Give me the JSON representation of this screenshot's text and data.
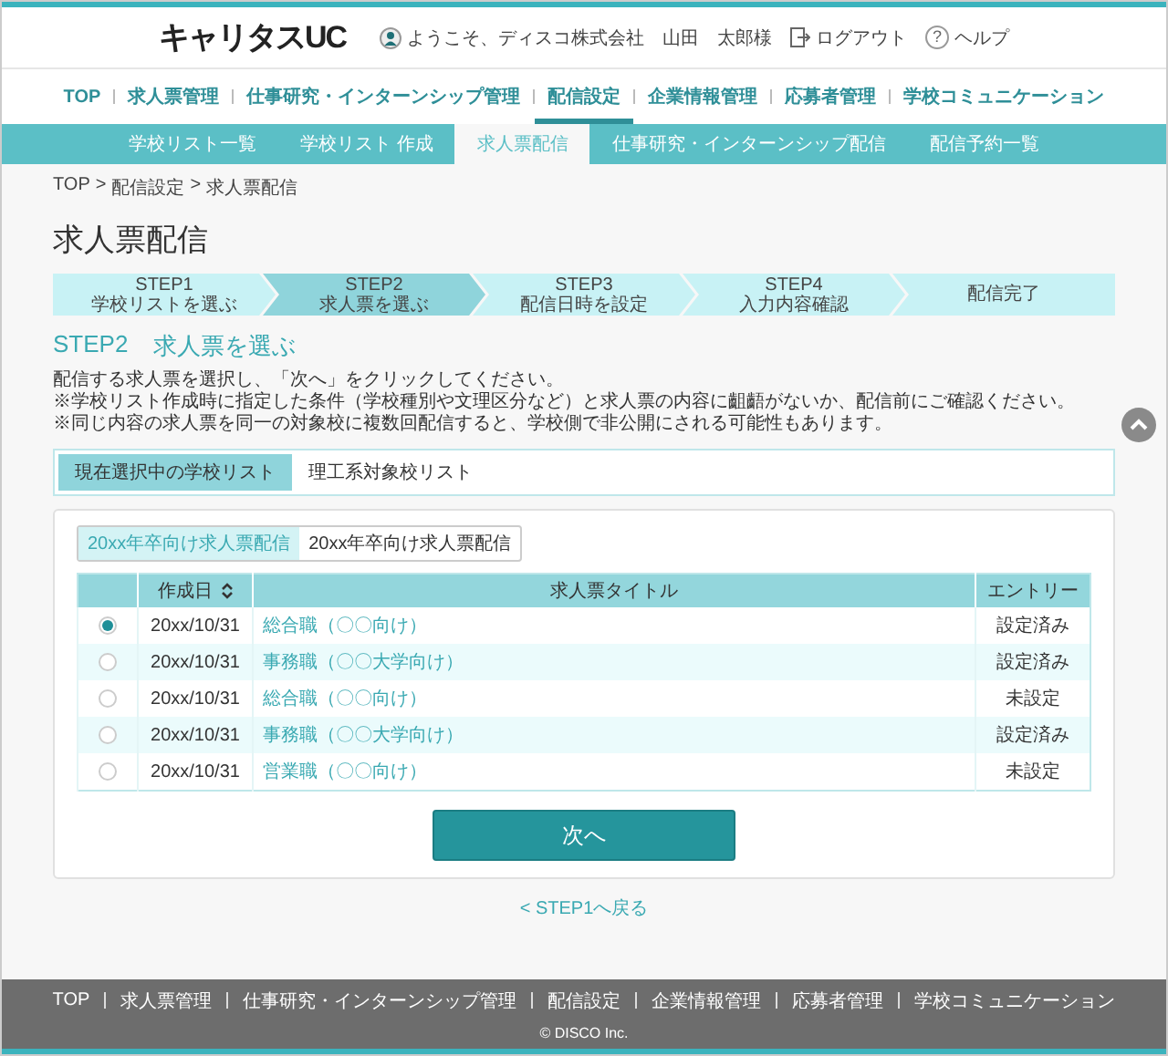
{
  "header": {
    "logo": "キャリタスUC",
    "welcome": "ようこそ、ディスコ株式会社　山田　太郎様",
    "logout": "ログアウト",
    "help": {
      "icon": "?",
      "label": "ヘルプ"
    }
  },
  "main_nav": [
    {
      "label": "TOP",
      "selected": false
    },
    {
      "label": "求人票管理",
      "selected": false
    },
    {
      "label": "仕事研究・インターンシップ管理",
      "selected": false
    },
    {
      "label": "配信設定",
      "selected": true
    },
    {
      "label": "企業情報管理",
      "selected": false
    },
    {
      "label": "応募者管理",
      "selected": false
    },
    {
      "label": "学校コミュニケーション",
      "selected": false
    }
  ],
  "sub_nav": [
    {
      "label": "学校リスト一覧",
      "selected": false
    },
    {
      "label": "学校リスト 作成",
      "selected": false
    },
    {
      "label": "求人票配信",
      "selected": true
    },
    {
      "label": "仕事研究・インターンシップ配信",
      "selected": false
    },
    {
      "label": "配信予約一覧",
      "selected": false
    }
  ],
  "breadcrumb": [
    "TOP",
    "配信設定",
    "求人票配信"
  ],
  "breadcrumb_separator": ">",
  "page_title": "求人票配信",
  "steps": [
    {
      "step": "STEP1",
      "label": "学校リストを選ぶ",
      "selected": false
    },
    {
      "step": "STEP2",
      "label": "求人票を選ぶ",
      "selected": true
    },
    {
      "step": "STEP3",
      "label": "配信日時を設定",
      "selected": false
    },
    {
      "step": "STEP4",
      "label": "入力内容確認",
      "selected": false
    },
    {
      "label": "配信完了",
      "selected": false
    }
  ],
  "section": {
    "step": "STEP2",
    "title": "求人票を選ぶ"
  },
  "instructions": "配信する求人票を選択し、「次へ」をクリックしてください。",
  "notes": [
    "※学校リスト作成時に指定した条件（学校種別や文理区分など）と求人票の内容に齟齬がないか、配信前にご確認ください。",
    "※同じ内容の求人票を同一の対象校に複数回配信すると、学校側で非公開にされる可能性もあります。"
  ],
  "list_tabs": [
    {
      "label": "現在選択中の学校リスト",
      "selected": true
    },
    {
      "label": "理工系対象校リスト",
      "selected": false
    }
  ],
  "year_tabs": [
    {
      "label": "20xx年卒向け求人票配信",
      "selected": true
    },
    {
      "label": "20xx年卒向け求人票配信",
      "selected": false
    }
  ],
  "table": {
    "columns": [
      "作成日",
      "求人票タイトル",
      "エントリー"
    ],
    "rows": [
      {
        "selected": true,
        "date": "20xx/10/31",
        "title": "総合職（〇〇向け）",
        "entry": "設定済み"
      },
      {
        "selected": false,
        "date": "20xx/10/31",
        "title": "事務職（〇〇大学向け）",
        "entry": "設定済み"
      },
      {
        "selected": false,
        "date": "20xx/10/31",
        "title": "総合職（〇〇向け）",
        "entry": "未設定"
      },
      {
        "selected": false,
        "date": "20xx/10/31",
        "title": "事務職（〇〇大学向け）",
        "entry": "設定済み"
      },
      {
        "selected": false,
        "date": "20xx/10/31",
        "title": "営業職（〇〇向け）",
        "entry": "未設定"
      }
    ]
  },
  "next_button": "次へ",
  "back_link": "< STEP1へ戻る",
  "footer": {
    "links": [
      "TOP",
      "求人票管理",
      "仕事研究・インターンシップ管理",
      "配信設定",
      "企業情報管理",
      "応募者管理",
      "学校コミュニケーション"
    ],
    "copyright": "© DISCO Inc."
  }
}
